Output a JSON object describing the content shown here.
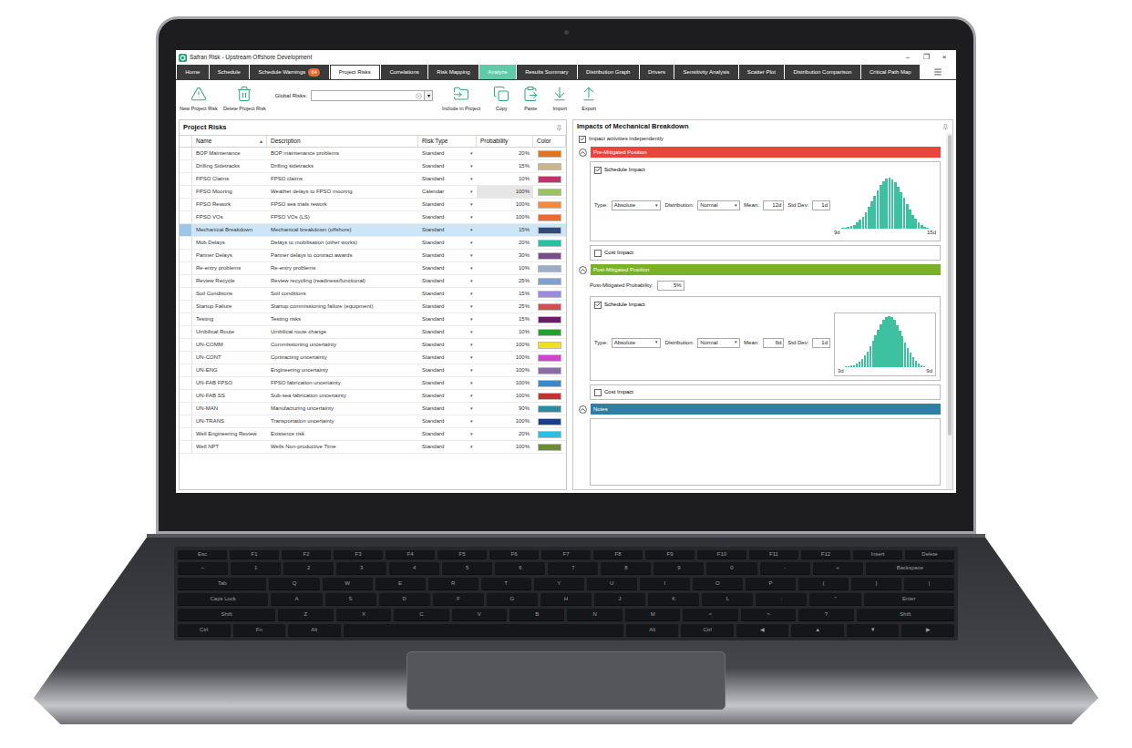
{
  "window": {
    "title": "Safran Risk - Upstream Offshore Development",
    "controls": [
      "–",
      "❐",
      "×"
    ]
  },
  "tabs": [
    {
      "label": "Home",
      "selected": false,
      "kind": "tab"
    },
    {
      "label": "Schedule",
      "selected": false,
      "kind": "tab"
    },
    {
      "label": "Schedule Warnings",
      "selected": false,
      "kind": "tab",
      "badge": "64"
    },
    {
      "label": "Project Risks",
      "selected": true,
      "kind": "tab"
    },
    {
      "label": "Correlations",
      "selected": false,
      "kind": "tab"
    },
    {
      "label": "Risk Mapping",
      "selected": false,
      "kind": "tab"
    },
    {
      "label": "Analyze",
      "selected": false,
      "kind": "accent"
    },
    {
      "label": "Results Summary",
      "selected": false,
      "kind": "tab"
    },
    {
      "label": "Distribution Graph",
      "selected": false,
      "kind": "tab"
    },
    {
      "label": "Drivers",
      "selected": false,
      "kind": "tab"
    },
    {
      "label": "Sensitivity Analysis",
      "selected": false,
      "kind": "tab"
    },
    {
      "label": "Scatter Plot",
      "selected": false,
      "kind": "tab"
    },
    {
      "label": "Distribution Comparison",
      "selected": false,
      "kind": "tab"
    },
    {
      "label": "Critical Path Map",
      "selected": false,
      "kind": "tab"
    }
  ],
  "toolbar": {
    "left_buttons": [
      "New Project Risk",
      "Delete Project Risk"
    ],
    "global_risks": {
      "label": "Global Risks:",
      "arrow": "▾"
    },
    "right_buttons": [
      "Include in Project",
      "Copy",
      "Paste",
      "Import",
      "Export"
    ]
  },
  "risks_panel": {
    "title": "Project Risks",
    "dropdown_glyph": "▾",
    "columns": [
      {
        "label": "Name",
        "sort": "▴"
      },
      {
        "label": "Description"
      },
      {
        "label": "Risk Type"
      },
      {
        "label": "Probability"
      },
      {
        "label": "Color"
      }
    ],
    "rows": [
      {
        "name": "BOP Maintenance",
        "description": "BOP maintenance problems",
        "type": "Standard",
        "probability": "20%",
        "color": "#e0741f",
        "selected": false,
        "probability_disabled": false
      },
      {
        "name": "Drilling Sidetracks",
        "description": "Drilling sidetracks",
        "type": "Standard",
        "probability": "15%",
        "color": "#c9b48e",
        "selected": false,
        "probability_disabled": false
      },
      {
        "name": "FPSO Claims",
        "description": "FPSO claims",
        "type": "Standard",
        "probability": "10%",
        "color": "#c2306b",
        "selected": false,
        "probability_disabled": false
      },
      {
        "name": "FPSO Mooring",
        "description": "Weather delays to FPSO mooring",
        "type": "Calendar",
        "probability": "100%",
        "color": "#9cc45c",
        "selected": false,
        "probability_disabled": true
      },
      {
        "name": "FPSO Rework",
        "description": "FPSO sea trials rework",
        "type": "Standard",
        "probability": "100%",
        "color": "#f48a3c",
        "selected": false,
        "probability_disabled": false
      },
      {
        "name": "FPSO VOs",
        "description": "FPSO VOs (LS)",
        "type": "Standard",
        "probability": "100%",
        "color": "#ef6a31",
        "selected": false,
        "probability_disabled": false
      },
      {
        "name": "Mechanical Breakdown",
        "description": "Mechanical breakdown (offshore)",
        "type": "Standard",
        "probability": "15%",
        "color": "#2e4b7c",
        "selected": true,
        "probability_disabled": false
      },
      {
        "name": "Mob Delays",
        "description": "Delays to mobilisation (other works)",
        "type": "Standard",
        "probability": "20%",
        "color": "#22c2a2",
        "selected": false,
        "probability_disabled": false
      },
      {
        "name": "Partner Delays",
        "description": "Partner delays to contract awards",
        "type": "Standard",
        "probability": "30%",
        "color": "#7a4b8c",
        "selected": false,
        "probability_disabled": false
      },
      {
        "name": "Re-entry problems",
        "description": "Re-entry problems",
        "type": "Standard",
        "probability": "10%",
        "color": "#9caccb",
        "selected": false,
        "probability_disabled": false
      },
      {
        "name": "Review Recycle",
        "description": "Review recycling (readiness/functional)",
        "type": "Standard",
        "probability": "25%",
        "color": "#7aa2d2",
        "selected": false,
        "probability_disabled": false
      },
      {
        "name": "Soil Conditions",
        "description": "Soil conditions",
        "type": "Standard",
        "probability": "15%",
        "color": "#9a8ae2",
        "selected": false,
        "probability_disabled": false
      },
      {
        "name": "Startup Failure",
        "description": "Startup commissioning failure (equipment)",
        "type": "Standard",
        "probability": "25%",
        "color": "#d24f4f",
        "selected": false,
        "probability_disabled": false
      },
      {
        "name": "Testing",
        "description": "Testing risks",
        "type": "Standard",
        "probability": "15%",
        "color": "#6b1b6b",
        "selected": false,
        "probability_disabled": false
      },
      {
        "name": "Umbilical Route",
        "description": "Umbilical route change",
        "type": "Standard",
        "probability": "10%",
        "color": "#22a22a",
        "selected": false,
        "probability_disabled": false
      },
      {
        "name": "UN-COMM",
        "description": "Commissioning uncertainty",
        "type": "Standard",
        "probability": "100%",
        "color": "#f0e022",
        "selected": false,
        "probability_disabled": false
      },
      {
        "name": "UN-CONT",
        "description": "Contracting uncertainty",
        "type": "Standard",
        "probability": "100%",
        "color": "#d243d2",
        "selected": false,
        "probability_disabled": false
      },
      {
        "name": "UN-ENG",
        "description": "Engineering uncertainty",
        "type": "Standard",
        "probability": "100%",
        "color": "#8a6cab",
        "selected": false,
        "probability_disabled": false
      },
      {
        "name": "UN-FAB FPSO",
        "description": "FPSO fabrication uncertainty",
        "type": "Standard",
        "probability": "100%",
        "color": "#3a8ac9",
        "selected": false,
        "probability_disabled": false
      },
      {
        "name": "UN-FAB SS",
        "description": "Sub-sea fabrication uncertainty",
        "type": "Standard",
        "probability": "100%",
        "color": "#c33232",
        "selected": false,
        "probability_disabled": false
      },
      {
        "name": "UN-MAN",
        "description": "Manufacturing uncertainty",
        "type": "Standard",
        "probability": "90%",
        "color": "#2a8ba2",
        "selected": false,
        "probability_disabled": false
      },
      {
        "name": "UN-TRANS",
        "description": "Transportation uncertainty",
        "type": "Standard",
        "probability": "100%",
        "color": "#1c3c8c",
        "selected": false,
        "probability_disabled": false
      },
      {
        "name": "Well Engineering Review",
        "description": "Existence risk",
        "type": "Standard",
        "probability": "20%",
        "color": "#22c2e2",
        "selected": false,
        "probability_disabled": false
      },
      {
        "name": "Well NPT",
        "description": "Wells Non-productive Time",
        "type": "Standard",
        "probability": "100%",
        "color": "#6b8b3b",
        "selected": false,
        "probability_disabled": false
      }
    ]
  },
  "impacts_panel": {
    "title": "Impacts of Mechanical Breakdown",
    "independent": {
      "label": "Impact activities independently",
      "checked": true
    },
    "pre": {
      "title": "Pre-Mitigated Position",
      "color": "#e8453c",
      "expanded": true,
      "schedule": {
        "label": "Schedule Impact",
        "checked": true,
        "type_label": "Type:",
        "type": "Absolute",
        "distribution_label": "Distribution:",
        "distribution": "Normal",
        "mean_label": "Mean:",
        "mean": "12d",
        "std_label": "Std Dev:",
        "std": "1d",
        "arrow": "▾",
        "histogram": {
          "values": [
            1,
            2,
            3,
            5,
            8,
            12,
            17,
            24,
            32,
            42,
            53,
            64,
            75,
            85,
            93,
            98,
            100,
            97,
            91,
            82,
            71,
            60,
            48,
            37,
            27,
            19,
            12,
            7,
            4,
            2
          ],
          "min": "9d",
          "max": "15d"
        }
      },
      "cost": {
        "label": "Cost Impact",
        "checked": false
      }
    },
    "post": {
      "title": "Post-Mitigated Position",
      "color": "#7ab126",
      "expanded": true,
      "probability_label": "Post-Mitigated Probability:",
      "probability": "5%",
      "schedule": {
        "label": "Schedule Impact",
        "checked": true,
        "type_label": "Type:",
        "type": "Absolute",
        "distribution_label": "Distribution:",
        "distribution": "Normal",
        "mean_label": "Mean:",
        "mean": "6d",
        "std_label": "Std Dev:",
        "std": "1d",
        "arrow": "▾",
        "histogram": {
          "values": [
            1,
            2,
            3,
            4,
            7,
            11,
            16,
            23,
            31,
            41,
            52,
            63,
            74,
            84,
            92,
            98,
            100,
            98,
            92,
            83,
            72,
            61,
            49,
            38,
            28,
            20,
            13,
            8,
            4,
            2
          ],
          "min": "3d",
          "max": "9d"
        }
      },
      "cost": {
        "label": "Cost Impact",
        "checked": false
      }
    },
    "notes": {
      "title": "Notes",
      "color": "#2e7fa8"
    }
  },
  "keyboard": {
    "rows": [
      [
        {
          "label": "Esc",
          "kind": "key"
        },
        {
          "label": "F1",
          "kind": "key"
        },
        {
          "label": "F2",
          "kind": "key"
        },
        {
          "label": "F3",
          "kind": "key"
        },
        {
          "label": "F4",
          "kind": "key"
        },
        {
          "label": "F5",
          "kind": "key"
        },
        {
          "label": "F6",
          "kind": "key"
        },
        {
          "label": "F7",
          "kind": "key"
        },
        {
          "label": "F8",
          "kind": "key"
        },
        {
          "label": "F9",
          "kind": "key"
        },
        {
          "label": "F10",
          "kind": "key"
        },
        {
          "label": "F11",
          "kind": "key"
        },
        {
          "label": "F12",
          "kind": "key"
        },
        {
          "label": "Insert",
          "kind": "key"
        },
        {
          "label": "Delete",
          "kind": "key"
        }
      ],
      [
        {
          "label": "~",
          "kind": "key"
        },
        {
          "label": "1",
          "kind": "key"
        },
        {
          "label": "2",
          "kind": "key"
        },
        {
          "label": "3",
          "kind": "key"
        },
        {
          "label": "4",
          "kind": "key"
        },
        {
          "label": "5",
          "kind": "key"
        },
        {
          "label": "6",
          "kind": "key"
        },
        {
          "label": "7",
          "kind": "key"
        },
        {
          "label": "8",
          "kind": "key"
        },
        {
          "label": "9",
          "kind": "key"
        },
        {
          "label": "0",
          "kind": "key"
        },
        {
          "label": "-",
          "kind": "key"
        },
        {
          "label": "+",
          "kind": "key"
        },
        {
          "label": "Backspace",
          "kind": "wide"
        }
      ],
      [
        {
          "label": "Tab",
          "kind": "wide"
        },
        {
          "label": "Q",
          "kind": "key"
        },
        {
          "label": "W",
          "kind": "key"
        },
        {
          "label": "E",
          "kind": "key"
        },
        {
          "label": "R",
          "kind": "key"
        },
        {
          "label": "T",
          "kind": "key"
        },
        {
          "label": "Y",
          "kind": "key"
        },
        {
          "label": "U",
          "kind": "key"
        },
        {
          "label": "I",
          "kind": "key"
        },
        {
          "label": "O",
          "kind": "key"
        },
        {
          "label": "P",
          "kind": "key"
        },
        {
          "label": "{",
          "kind": "key"
        },
        {
          "label": "}",
          "kind": "key"
        },
        {
          "label": "|",
          "kind": "key"
        }
      ],
      [
        {
          "label": "Caps Lock",
          "kind": "wide"
        },
        {
          "label": "A",
          "kind": "key"
        },
        {
          "label": "S",
          "kind": "key"
        },
        {
          "label": "D",
          "kind": "key"
        },
        {
          "label": "F",
          "kind": "key"
        },
        {
          "label": "G",
          "kind": "key"
        },
        {
          "label": "H",
          "kind": "key"
        },
        {
          "label": "J",
          "kind": "key"
        },
        {
          "label": "K",
          "kind": "key"
        },
        {
          "label": "L",
          "kind": "key"
        },
        {
          "label": ":",
          "kind": "key"
        },
        {
          "label": "\"",
          "kind": "key"
        },
        {
          "label": "Enter",
          "kind": "wide"
        }
      ],
      [
        {
          "label": "Shift",
          "kind": "wide"
        },
        {
          "label": "Z",
          "kind": "key"
        },
        {
          "label": "X",
          "kind": "key"
        },
        {
          "label": "C",
          "kind": "key"
        },
        {
          "label": "V",
          "kind": "key"
        },
        {
          "label": "B",
          "kind": "key"
        },
        {
          "label": "N",
          "kind": "key"
        },
        {
          "label": "M",
          "kind": "key"
        },
        {
          "label": "<",
          "kind": "key"
        },
        {
          "label": ">",
          "kind": "key"
        },
        {
          "label": "?",
          "kind": "key"
        },
        {
          "label": "Shift",
          "kind": "wide"
        }
      ],
      [
        {
          "label": "Ctrl",
          "kind": "key"
        },
        {
          "label": "Fn",
          "kind": "key"
        },
        {
          "label": "Alt",
          "kind": "key"
        },
        {
          "kind": "space"
        },
        {
          "label": "Alt",
          "kind": "key"
        },
        {
          "label": "Ctrl",
          "kind": "key"
        },
        {
          "label": "◀",
          "kind": "key"
        },
        {
          "label": "▲",
          "kind": "key"
        },
        {
          "label": "▼",
          "kind": "key"
        },
        {
          "label": "▶",
          "kind": "key"
        }
      ]
    ]
  }
}
